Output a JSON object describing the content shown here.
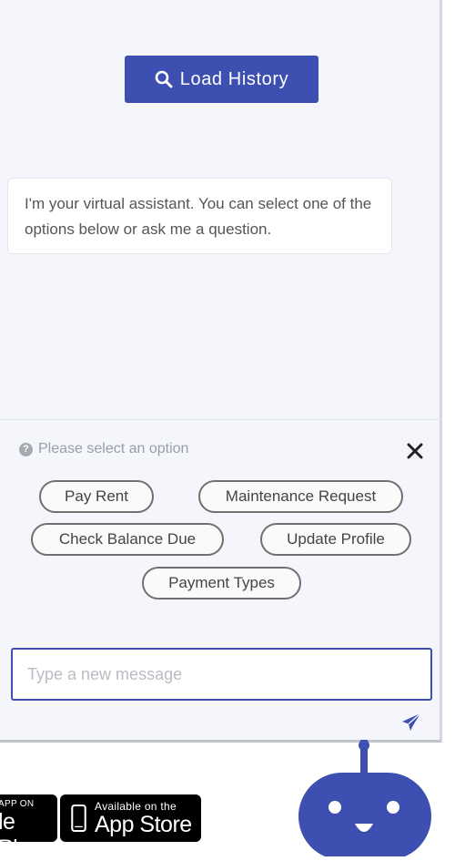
{
  "chat": {
    "load_history_label": "Load History",
    "welcome_message": "I'm your virtual assistant. You can select one of the options below or ask me a question."
  },
  "options_panel": {
    "prompt": "Please select an option",
    "options": [
      "Pay Rent",
      "Maintenance Request",
      "Check Balance Due",
      "Update Profile",
      "Payment Types"
    ]
  },
  "composer": {
    "placeholder": "Type a new message",
    "value": ""
  },
  "footer": {
    "google_play": {
      "small": "APP ON",
      "big": "le Play"
    },
    "app_store": {
      "small": "Available on the",
      "big": "App Store"
    }
  },
  "icons": {
    "load_history": "search-icon",
    "prompt": "question-icon",
    "close": "close-icon",
    "send": "send-icon",
    "bot": "chatbot-icon"
  },
  "colors": {
    "accent": "#3d4fb0",
    "panel_bg": "#f4f6fb"
  }
}
